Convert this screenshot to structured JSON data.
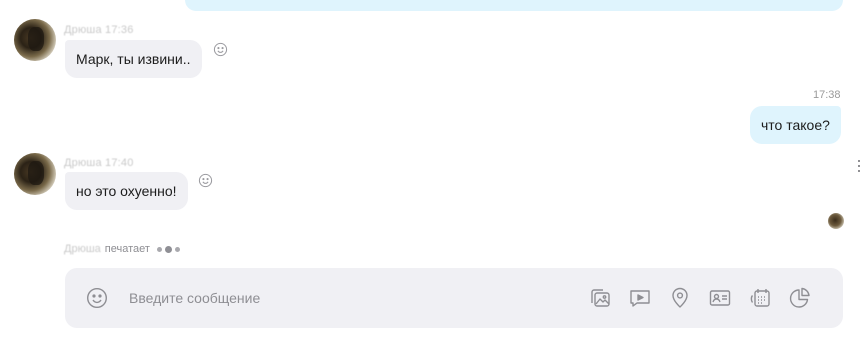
{
  "messages": [
    {
      "direction": "incoming",
      "sender_and_time": "Дрюша 17:36",
      "text": "Марк, ты извини..",
      "reaction_icon": "smile-icon"
    },
    {
      "direction": "outgoing",
      "time": "17:38",
      "text": "что такое?"
    },
    {
      "direction": "incoming",
      "sender_and_time": "Дрюша 17:40",
      "text": "но это охуенно!",
      "reaction_icon": "smile-icon"
    }
  ],
  "typing": {
    "who": "Дрюша",
    "label": "печатает"
  },
  "composer": {
    "placeholder": "Введите сообщение",
    "tools": [
      "emoji-icon",
      "photo-icon",
      "video-icon",
      "location-icon",
      "contact-card-icon",
      "calendar-icon",
      "poll-chart-icon"
    ]
  },
  "colors": {
    "incoming_bubble": "#f0f0f4",
    "outgoing_bubble": "#dff4fd",
    "icon_gray": "#8e8e93"
  }
}
